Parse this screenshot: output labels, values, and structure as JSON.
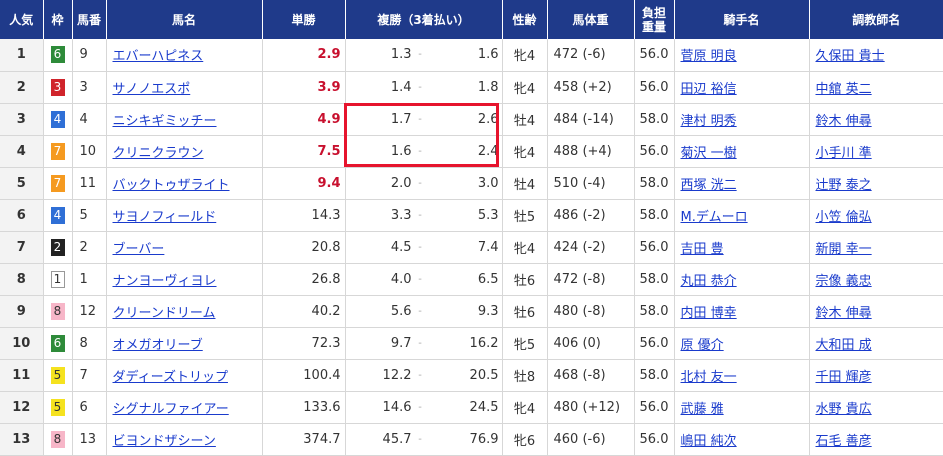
{
  "header": {
    "popularity": "人気",
    "waku": "枠",
    "umaban": "馬番",
    "horse": "馬名",
    "win": "単勝",
    "place": "複勝（3着払い）",
    "sexage": "性齢",
    "weight": "馬体重",
    "burden_top": "負担",
    "burden_bottom": "重量",
    "jockey": "騎手名",
    "trainer": "調教師名"
  },
  "waku_colors": {
    "1": {
      "bg": "#ffffff",
      "fg": "#333333",
      "border": "#999999"
    },
    "2": {
      "bg": "#222222",
      "fg": "#ffffff"
    },
    "3": {
      "bg": "#d0242b",
      "fg": "#ffffff"
    },
    "4": {
      "bg": "#2f6fd6",
      "fg": "#ffffff"
    },
    "5": {
      "bg": "#f5e21f",
      "fg": "#333333"
    },
    "6": {
      "bg": "#2e8b3a",
      "fg": "#ffffff"
    },
    "7": {
      "bg": "#f59a20",
      "fg": "#ffffff"
    },
    "8": {
      "bg": "#f7b6c8",
      "fg": "#333333"
    }
  },
  "rows": [
    {
      "pop": "1",
      "waku": "6",
      "num": "9",
      "horse": "エバーハピネス",
      "win": "2.9",
      "hot": true,
      "plo": "1.3",
      "phi": "1.6",
      "sexage": "牝4",
      "weight": "472 (-6)",
      "burden": "56.0",
      "jockey": "菅原 明良",
      "trainer": "久保田 貴士"
    },
    {
      "pop": "2",
      "waku": "3",
      "num": "3",
      "horse": "サノノエスポ",
      "win": "3.9",
      "hot": true,
      "plo": "1.4",
      "phi": "1.8",
      "sexage": "牝4",
      "weight": "458 (+2)",
      "burden": "56.0",
      "jockey": "田辺 裕信",
      "trainer": "中舘 英二"
    },
    {
      "pop": "3",
      "waku": "4",
      "num": "4",
      "horse": "ニシキギミッチー",
      "win": "4.9",
      "hot": true,
      "plo": "1.7",
      "phi": "2.6",
      "sexage": "牡4",
      "weight": "484 (-14)",
      "burden": "58.0",
      "jockey": "津村 明秀",
      "trainer": "鈴木 伸尋"
    },
    {
      "pop": "4",
      "waku": "7",
      "num": "10",
      "horse": "クリニクラウン",
      "win": "7.5",
      "hot": true,
      "plo": "1.6",
      "phi": "2.4",
      "sexage": "牝4",
      "weight": "488 (+4)",
      "burden": "56.0",
      "jockey": "菊沢 一樹",
      "trainer": "小手川 準"
    },
    {
      "pop": "5",
      "waku": "7",
      "num": "11",
      "horse": "バックトゥザライト",
      "win": "9.4",
      "hot": true,
      "plo": "2.0",
      "phi": "3.0",
      "sexage": "牡4",
      "weight": "510 (-4)",
      "burden": "58.0",
      "jockey": "西塚 洸二",
      "trainer": "辻野 泰之"
    },
    {
      "pop": "6",
      "waku": "4",
      "num": "5",
      "horse": "サヨノフィールド",
      "win": "14.3",
      "hot": false,
      "plo": "3.3",
      "phi": "5.3",
      "sexage": "牡5",
      "weight": "486 (-2)",
      "burden": "58.0",
      "jockey": "M.デムーロ",
      "trainer": "小笠 倫弘"
    },
    {
      "pop": "7",
      "waku": "2",
      "num": "2",
      "horse": "ブーバー",
      "win": "20.8",
      "hot": false,
      "plo": "4.5",
      "phi": "7.4",
      "sexage": "牝4",
      "weight": "424 (-2)",
      "burden": "56.0",
      "jockey": "吉田 豊",
      "trainer": "新開 幸一"
    },
    {
      "pop": "8",
      "waku": "1",
      "num": "1",
      "horse": "ナンヨーヴィヨレ",
      "win": "26.8",
      "hot": false,
      "plo": "4.0",
      "phi": "6.5",
      "sexage": "牡6",
      "weight": "472 (-8)",
      "burden": "58.0",
      "jockey": "丸田 恭介",
      "trainer": "宗像 義忠"
    },
    {
      "pop": "9",
      "waku": "8",
      "num": "12",
      "horse": "クリーンドリーム",
      "win": "40.2",
      "hot": false,
      "plo": "5.6",
      "phi": "9.3",
      "sexage": "牡6",
      "weight": "480 (-8)",
      "burden": "58.0",
      "jockey": "内田 博幸",
      "trainer": "鈴木 伸尋"
    },
    {
      "pop": "10",
      "waku": "6",
      "num": "8",
      "horse": "オメガオリーブ",
      "win": "72.3",
      "hot": false,
      "plo": "9.7",
      "phi": "16.2",
      "sexage": "牝5",
      "weight": "406 (0)",
      "burden": "56.0",
      "jockey": "原 優介",
      "trainer": "大和田 成"
    },
    {
      "pop": "11",
      "waku": "5",
      "num": "7",
      "horse": "ダディーズトリップ",
      "win": "100.4",
      "hot": false,
      "plo": "12.2",
      "phi": "20.5",
      "sexage": "牡8",
      "weight": "468 (-8)",
      "burden": "58.0",
      "jockey": "北村 友一",
      "trainer": "千田 輝彦"
    },
    {
      "pop": "12",
      "waku": "5",
      "num": "6",
      "horse": "シグナルファイアー",
      "win": "133.6",
      "hot": false,
      "plo": "14.6",
      "phi": "24.5",
      "sexage": "牝4",
      "weight": "480 (+12)",
      "burden": "56.0",
      "jockey": "武藤 雅",
      "trainer": "水野 貴広"
    },
    {
      "pop": "13",
      "waku": "8",
      "num": "13",
      "horse": "ビヨンドザシーン",
      "win": "374.7",
      "hot": false,
      "plo": "45.7",
      "phi": "76.9",
      "sexage": "牝6",
      "weight": "460 (-6)",
      "burden": "56.0",
      "jockey": "嶋田 純次",
      "trainer": "石毛 善彦"
    }
  ]
}
